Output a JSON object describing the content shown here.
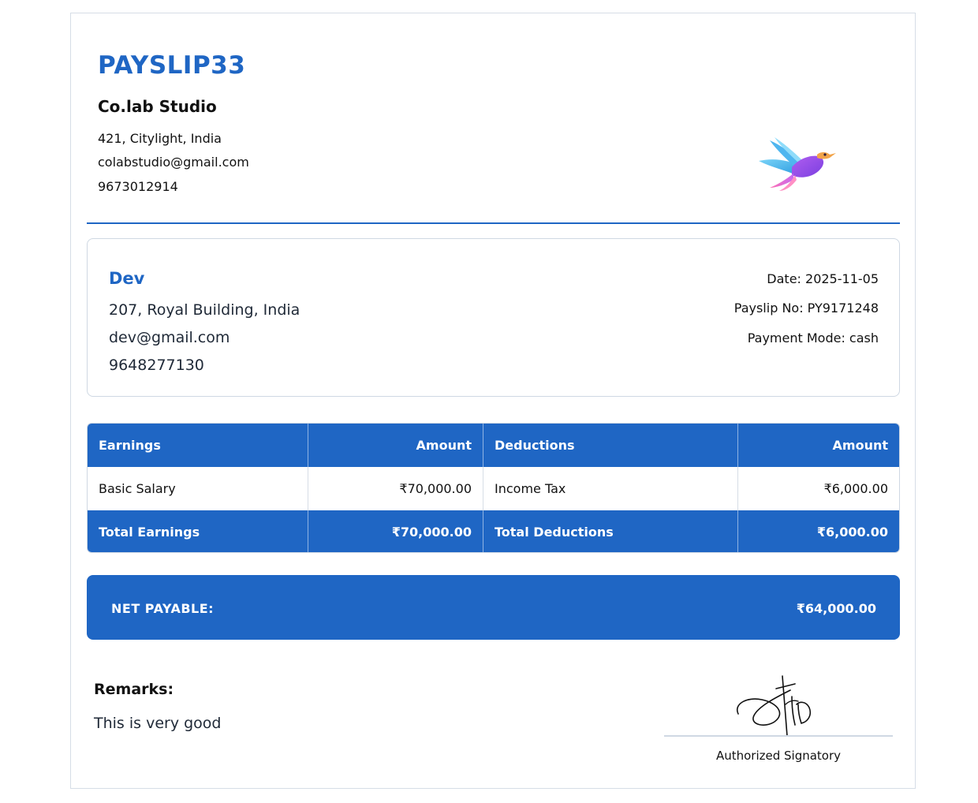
{
  "header": {
    "title": "PAYSLIP33",
    "company_name": "Co.lab Studio",
    "company_address": "421, Citylight, India",
    "company_email": "colabstudio@gmail.com",
    "company_phone": "9673012914",
    "logo_icon": "hummingbird-icon",
    "accent_color": "#1f66c4"
  },
  "employee": {
    "name": "Dev",
    "address": "207, Royal Building, India",
    "email": "dev@gmail.com",
    "phone": "9648277130"
  },
  "meta": {
    "date": "Date: 2025-11-05",
    "payslip_no": "Payslip No: PY9171248",
    "payment_mode": "Payment Mode: cash"
  },
  "table": {
    "headers": [
      "Earnings",
      "Amount",
      "Deductions",
      "Amount"
    ],
    "rows": [
      [
        "Basic Salary",
        "₹70,000.00",
        "Income Tax",
        "₹6,000.00"
      ]
    ],
    "totals": [
      "Total Earnings",
      "₹70,000.00",
      "Total Deductions",
      "₹6,000.00"
    ]
  },
  "net": {
    "label": "NET PAYABLE:",
    "value": "₹64,000.00"
  },
  "remarks": {
    "label": "Remarks:",
    "text": "This is very good"
  },
  "signature": {
    "label": "Authorized Signatory"
  }
}
